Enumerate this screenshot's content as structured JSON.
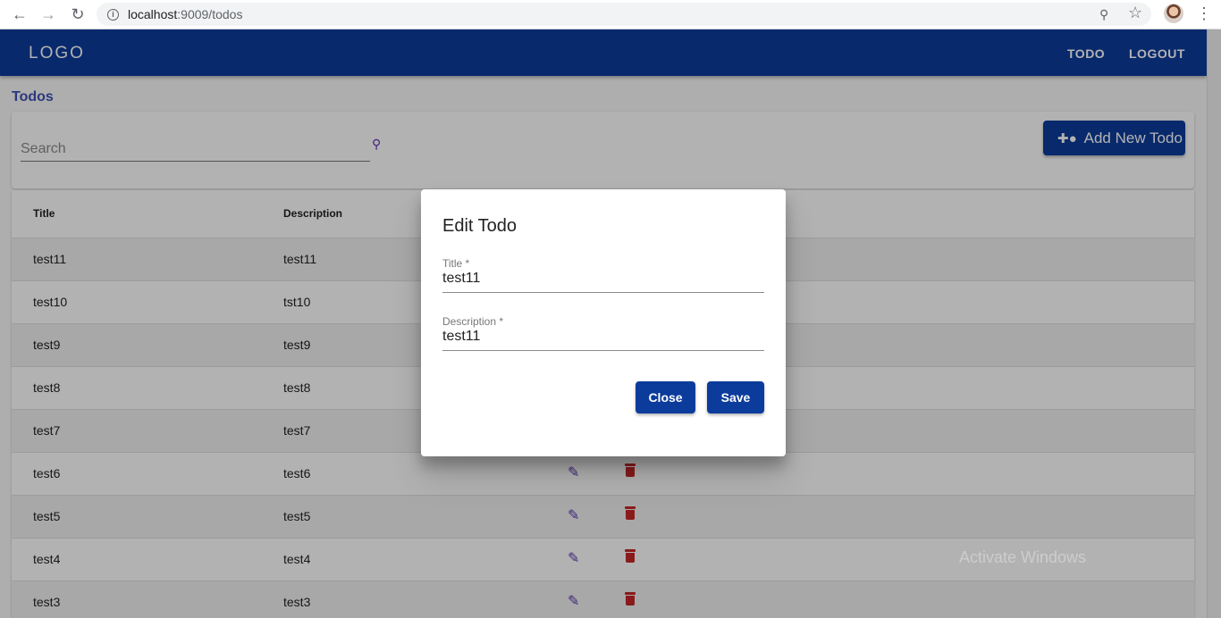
{
  "browser": {
    "url_host": "localhost",
    "url_rest": ":9009/todos"
  },
  "appbar": {
    "logo": "LOGO",
    "nav_todo": "TODO",
    "nav_logout": "LOGOUT"
  },
  "page": {
    "title": "Todos",
    "search_placeholder": "Search",
    "add_button_label": "Add New Todo"
  },
  "table": {
    "headers": [
      "Title",
      "Description"
    ],
    "rows": [
      {
        "title": "test11",
        "description": "test11"
      },
      {
        "title": "test10",
        "description": "tst10"
      },
      {
        "title": "test9",
        "description": "test9"
      },
      {
        "title": "test8",
        "description": "test8"
      },
      {
        "title": "test7",
        "description": "test7"
      },
      {
        "title": "test6",
        "description": "test6"
      },
      {
        "title": "test5",
        "description": "test5"
      },
      {
        "title": "test4",
        "description": "test4"
      },
      {
        "title": "test3",
        "description": "test3"
      }
    ]
  },
  "dialog": {
    "title": "Edit Todo",
    "title_label": "Title *",
    "title_value": "test11",
    "description_label": "Description *",
    "description_value": "test11",
    "close_label": "Close",
    "save_label": "Save"
  },
  "watermark": "Activate Windows",
  "colors": {
    "primary": "#0c3c9b",
    "accent": "#5e35b1",
    "danger": "#c62828"
  }
}
